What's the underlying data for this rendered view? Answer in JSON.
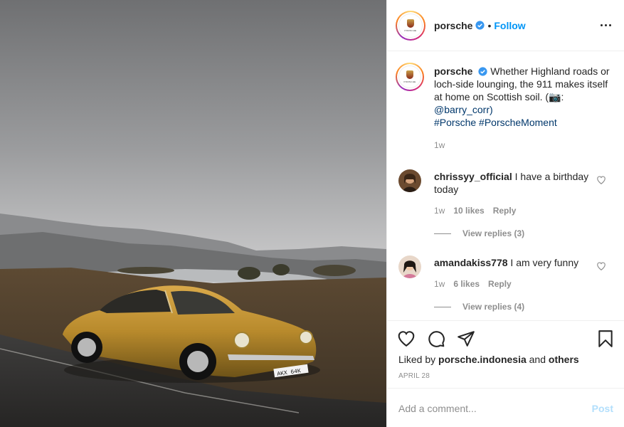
{
  "photo": {
    "alt_icon": "porsche-911-photo",
    "plate_text": "AKX 64K"
  },
  "header": {
    "username": "porsche",
    "separator": "•",
    "follow_label": "Follow",
    "avatar_text": "PORSCHE"
  },
  "caption": {
    "username": "porsche",
    "text": "Whether Highland roads or loch-side lounging, the 911 makes itself at home on Scottish soil. (📷:",
    "mention": "@barry_corr)",
    "hashtags": "#Porsche #PorscheMoment",
    "time": "1w"
  },
  "comments": [
    {
      "username": "chrissyy_official",
      "text": "I have a birthday today",
      "time": "1w",
      "likes": "10 likes",
      "reply_label": "Reply",
      "view_replies": "View replies (3)"
    },
    {
      "username": "amandakiss778",
      "text": "I am very funny",
      "time": "1w",
      "likes": "6 likes",
      "reply_label": "Reply",
      "view_replies": "View replies (4)"
    }
  ],
  "actions": {
    "liked_prefix": "Liked by",
    "liked_user": "porsche.indonesia",
    "liked_and": "and",
    "liked_others": "others",
    "date": "APRIL 28"
  },
  "composer": {
    "placeholder": "Add a comment...",
    "post_label": "Post"
  },
  "colors": {
    "accent": "#0095f6",
    "link": "#00376b",
    "muted": "#8e8e8e",
    "post_disabled": "#b2dffc"
  }
}
